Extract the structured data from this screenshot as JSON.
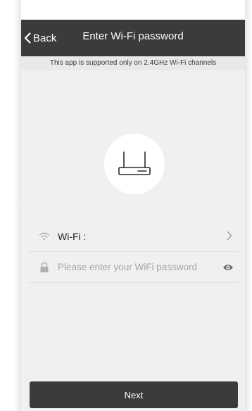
{
  "nav": {
    "back_label": "Back",
    "title": "Enter Wi-Fi password",
    "notice": "This app is supported only on 2.4GHz Wi-Fi channels"
  },
  "wifi_row": {
    "label": "Wi-Fi :",
    "icon": "wifi-icon",
    "action_icon": "chevron-right-icon"
  },
  "password_row": {
    "icon": "lock-icon",
    "placeholder": "Please enter your WiFi password",
    "value": "",
    "toggle_icon": "eye-icon"
  },
  "hero_icon": "router-icon",
  "next_label": "Next",
  "colors": {
    "header_bg": "#3b3b3b",
    "screen_bg": "#f0f0f0",
    "button_bg": "#3b3b3b",
    "placeholder": "#a6a6a6"
  }
}
